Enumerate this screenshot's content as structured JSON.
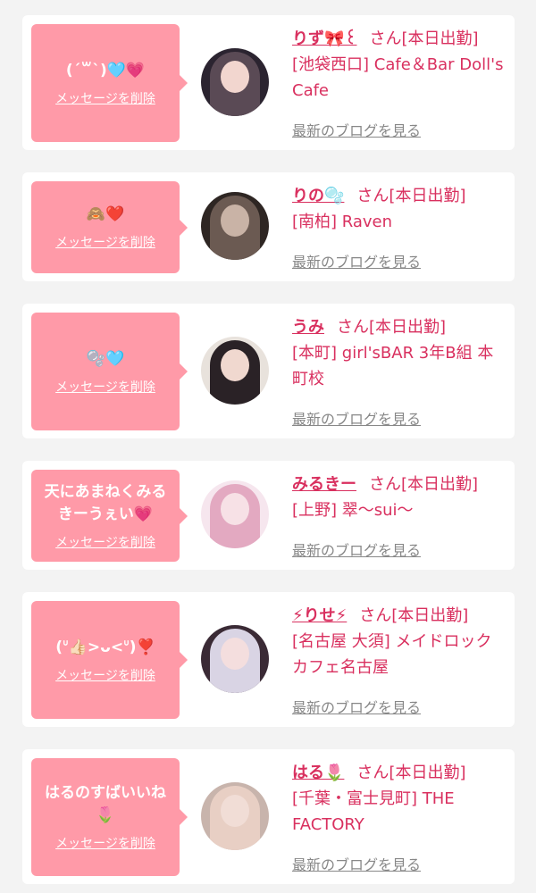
{
  "common": {
    "delete_label": "メッセージを削除",
    "blog_label": "最新のブログを見る",
    "san_label": "さん[本日出勤]"
  },
  "cards": [
    {
      "message": "(ˊ꒳ˋ)🩵💗",
      "name": "りず🎀꒰",
      "shop": "[池袋西口] Cafe＆Bar Doll's Cafe",
      "avatar_colors": [
        "#2b2430",
        "#f2d6cf",
        "#5a4a55"
      ]
    },
    {
      "message": "🙈❤️",
      "name": "りの🫧",
      "shop": "[南柏] Raven",
      "avatar_colors": [
        "#2e2623",
        "#c9b3a6",
        "#6b5a52"
      ]
    },
    {
      "message": "🫧🩵",
      "name": "うみ",
      "shop": "[本町] girl'sBAR 3年B組 本町校",
      "avatar_colors": [
        "#e8e2dc",
        "#f0d8cf",
        "#2a2226"
      ]
    },
    {
      "message": "天にあまねくみるきーうぇい💗",
      "name": "みるきー",
      "shop": "[上野] 翠〜sui〜",
      "avatar_colors": [
        "#f6e6ee",
        "#f7e1e6",
        "#e3a9c1"
      ]
    },
    {
      "message": "(ᐡ👍🏻>ᴗ<ᐡ)❣️",
      "name": "⚡りせ⚡",
      "shop": "[名古屋 大須] メイドロックカフェ名古屋",
      "avatar_colors": [
        "#3a2a35",
        "#f4dede",
        "#d9d4e4"
      ]
    },
    {
      "message": "はるのすばいいね🌷",
      "name": "はる🌷",
      "shop": "[千葉・富士見町] THE FACTORY",
      "avatar_colors": [
        "#c8b4ac",
        "#f1ddd6",
        "#e8cfc4"
      ]
    }
  ]
}
